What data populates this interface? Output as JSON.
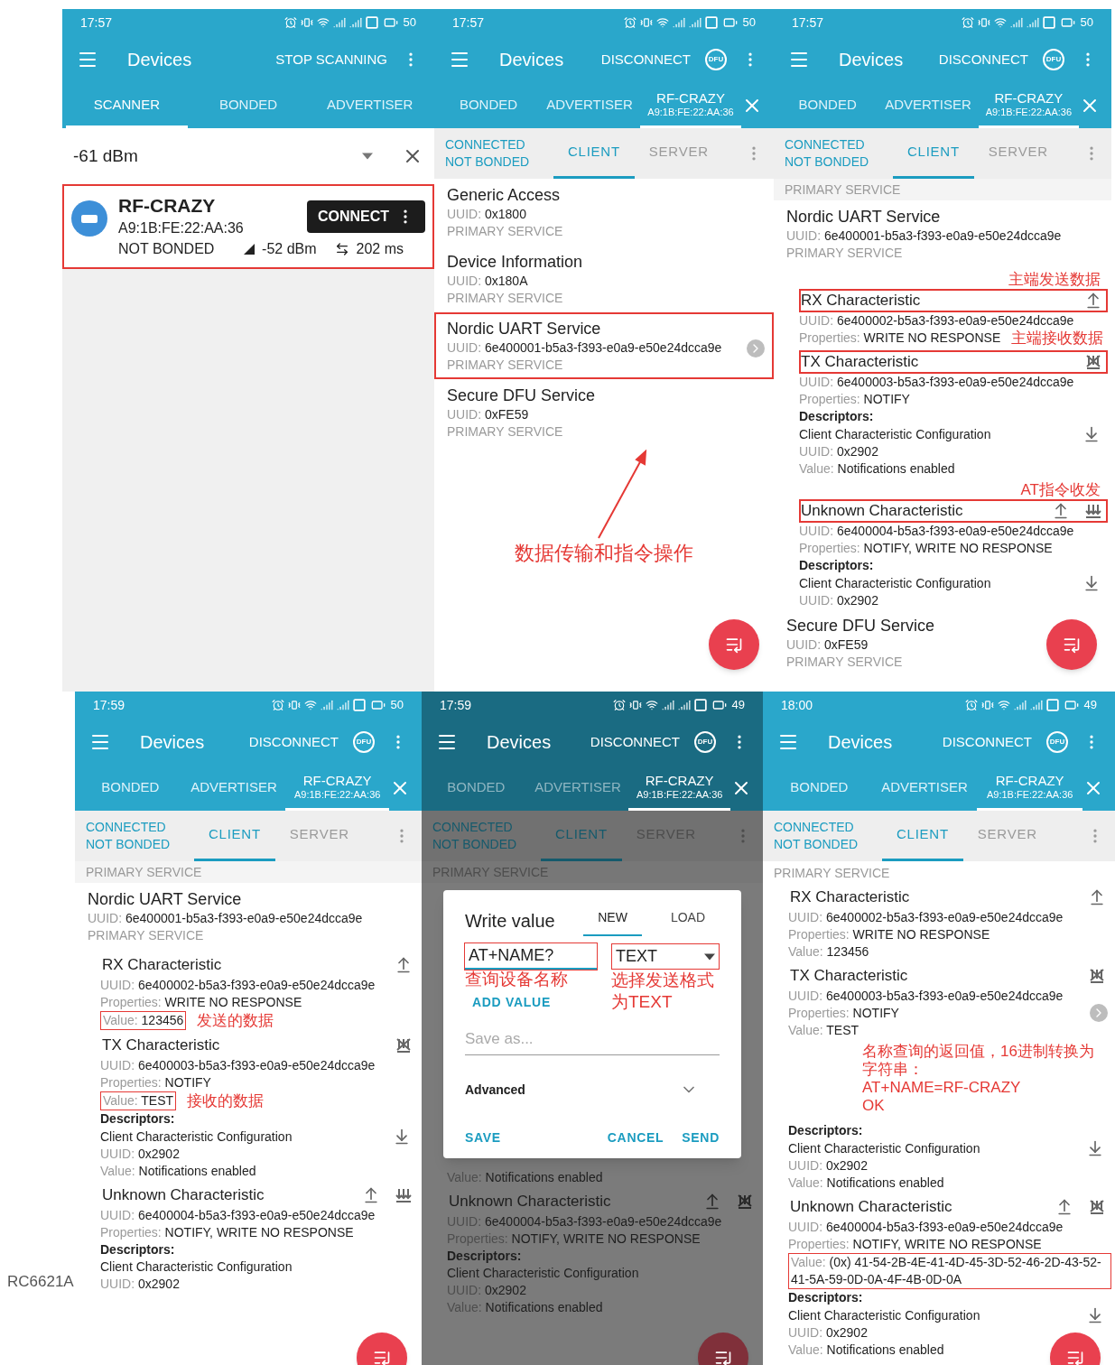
{
  "rows": [
    {
      "panels": [
        {
          "time": "17:57",
          "battery": "50",
          "title": "Devices",
          "action": "STOP SCANNING",
          "dimmed": false,
          "tabs": [
            {
              "label": "SCANNER",
              "selected": true
            },
            {
              "label": "BONDED",
              "selected": false
            },
            {
              "label": "ADVERTISER",
              "selected": false
            }
          ],
          "blocks": [
            {
              "kind": "filter",
              "value": "-61 dBm"
            },
            {
              "kind": "device",
              "boxed": true,
              "name": "RF-CRAZY",
              "address": "A9:1B:FE:22:AA:36",
              "bond": "NOT BONDED",
              "rssi": "-52 dBm",
              "interval": "202 ms",
              "button": "CONNECT"
            }
          ]
        },
        {
          "time": "17:57",
          "battery": "50",
          "title": "Devices",
          "action": "DISCONNECT",
          "dfu": "DFU",
          "dimmed": false,
          "fab": true,
          "closable": true,
          "tabs": [
            {
              "label": "BONDED",
              "selected": false
            },
            {
              "label": "ADVERTISER",
              "selected": false
            },
            {
              "label": "RF-CRAZY",
              "sublabel": "A9:1B:FE:22:AA:36",
              "selected": true
            }
          ],
          "subbar": {
            "status": [
              "CONNECTED",
              "NOT BONDED"
            ],
            "tabs": [
              {
                "label": "CLIENT",
                "selected": true
              },
              {
                "label": "SERVER",
                "selected": false
              }
            ]
          },
          "blocks": [
            {
              "kind": "service",
              "name": "Generic Access",
              "boxed": false,
              "lines": [
                {
                  "label": "UUID:",
                  "value": "0x1800"
                },
                {
                  "label": "PRIMARY SERVICE"
                }
              ]
            },
            {
              "kind": "service",
              "name": "Device Information",
              "boxed": false,
              "lines": [
                {
                  "label": "UUID:",
                  "value": "0x180A"
                },
                {
                  "label": "PRIMARY SERVICE"
                }
              ]
            },
            {
              "kind": "service",
              "name": "Nordic UART Service",
              "boxed": true,
              "chevron": true,
              "lines": [
                {
                  "label": "UUID:",
                  "value": "6e400001-b5a3-f393-e0a9-e50e24dcca9e"
                },
                {
                  "label": "PRIMARY SERVICE"
                }
              ]
            },
            {
              "kind": "service",
              "name": "Secure DFU Service",
              "boxed": false,
              "lines": [
                {
                  "label": "UUID:",
                  "value": "0xFE59"
                },
                {
                  "label": "PRIMARY SERVICE"
                }
              ]
            },
            {
              "kind": "note",
              "arrow": true,
              "lines": [
                "数据传输和指令操作"
              ]
            }
          ]
        },
        {
          "time": "17:57",
          "battery": "50",
          "title": "Devices",
          "action": "DISCONNECT",
          "dfu": "DFU",
          "dimmed": false,
          "fab": true,
          "closable": true,
          "tabs": [
            {
              "label": "BONDED",
              "selected": false
            },
            {
              "label": "ADVERTISER",
              "selected": false
            },
            {
              "label": "RF-CRAZY",
              "sublabel": "A9:1B:FE:22:AA:36",
              "selected": true
            }
          ],
          "subbar": {
            "status": [
              "CONNECTED",
              "NOT BONDED"
            ],
            "tabs": [
              {
                "label": "CLIENT",
                "selected": true
              },
              {
                "label": "SERVER",
                "selected": false
              }
            ]
          },
          "blocks": [
            {
              "kind": "label",
              "text": "PRIMARY SERVICE"
            },
            {
              "kind": "service",
              "name": "Nordic UART Service",
              "boxed": false,
              "lines": [
                {
                  "label": "UUID:",
                  "value": "6e400001-b5a3-f393-e0a9-e50e24dcca9e"
                },
                {
                  "label": "PRIMARY SERVICE"
                }
              ]
            },
            {
              "kind": "characteristic",
              "note": "主端发送数据",
              "name": "RX Characteristic",
              "boxed": true,
              "writable": true,
              "lines": [
                {
                  "label": "UUID:",
                  "value": "6e400002-b5a3-f393-e0a9-e50e24dcca9e"
                },
                {
                  "label": "Properties:",
                  "value": "WRITE NO RESPONSE",
                  "note": "主端接收数据"
                }
              ]
            },
            {
              "kind": "characteristic",
              "name": "TX Characteristic",
              "boxed": true,
              "notifying": false,
              "lines": [
                {
                  "label": "UUID:",
                  "value": "6e400003-b5a3-f393-e0a9-e50e24dcca9e"
                },
                {
                  "label": "Properties:",
                  "value": "NOTIFY"
                }
              ],
              "descriptors": {
                "heading": "Descriptors:",
                "items": [
                  {
                    "name": "Client Characteristic Configuration",
                    "readable": true,
                    "lines": [
                      {
                        "label": "UUID:",
                        "value": "0x2902"
                      },
                      {
                        "label": "Value:",
                        "value": "Notifications enabled"
                      }
                    ]
                  }
                ]
              }
            },
            {
              "kind": "characteristic",
              "note": "AT指令收发",
              "name": "Unknown Characteristic",
              "boxed": true,
              "writable": true,
              "notifying": true,
              "lines": [
                {
                  "label": "UUID:",
                  "value": "6e400004-b5a3-f393-e0a9-e50e24dcca9e"
                },
                {
                  "label": "Properties:",
                  "value": "NOTIFY, WRITE NO RESPONSE"
                }
              ],
              "descriptors": {
                "heading": "Descriptors:",
                "items": [
                  {
                    "name": "Client Characteristic Configuration",
                    "readable": true,
                    "lines": [
                      {
                        "label": "UUID:",
                        "value": "0x2902"
                      }
                    ]
                  }
                ]
              }
            },
            {
              "kind": "service",
              "name": "Secure DFU Service",
              "boxed": false,
              "lines": [
                {
                  "label": "UUID:",
                  "value": "0xFE59"
                },
                {
                  "label": "PRIMARY SERVICE"
                }
              ]
            }
          ]
        }
      ]
    },
    {
      "side_text": "RC6621A",
      "panels": [
        {
          "time": "17:59",
          "battery": "50",
          "title": "Devices",
          "action": "DISCONNECT",
          "dfu": "DFU",
          "dimmed": false,
          "fab": true,
          "closable": true,
          "tabs": [
            {
              "label": "BONDED",
              "selected": false
            },
            {
              "label": "ADVERTISER",
              "selected": false
            },
            {
              "label": "RF-CRAZY",
              "sublabel": "A9:1B:FE:22:AA:36",
              "selected": true
            }
          ],
          "subbar": {
            "status": [
              "CONNECTED",
              "NOT BONDED"
            ],
            "tabs": [
              {
                "label": "CLIENT",
                "selected": true
              },
              {
                "label": "SERVER",
                "selected": false
              }
            ]
          },
          "blocks": [
            {
              "kind": "label",
              "text": "PRIMARY SERVICE"
            },
            {
              "kind": "service",
              "name": "Nordic UART Service",
              "boxed": false,
              "lines": [
                {
                  "label": "UUID:",
                  "value": "6e400001-b5a3-f393-e0a9-e50e24dcca9e"
                },
                {
                  "label": "PRIMARY SERVICE"
                }
              ]
            },
            {
              "kind": "characteristic",
              "name": "RX Characteristic",
              "boxed": false,
              "writable": true,
              "lines": [
                {
                  "label": "UUID:",
                  "value": "6e400002-b5a3-f393-e0a9-e50e24dcca9e"
                },
                {
                  "label": "Properties:",
                  "value": "WRITE NO RESPONSE"
                },
                {
                  "label": "Value:",
                  "value": "123456",
                  "boxed": true,
                  "note": "发送的数据"
                }
              ]
            },
            {
              "kind": "characteristic",
              "name": "TX Characteristic",
              "boxed": false,
              "notifying": false,
              "lines": [
                {
                  "label": "UUID:",
                  "value": "6e400003-b5a3-f393-e0a9-e50e24dcca9e"
                },
                {
                  "label": "Properties:",
                  "value": "NOTIFY"
                },
                {
                  "label": "Value:",
                  "value": "TEST",
                  "boxed": true,
                  "note": "接收的数据"
                }
              ],
              "descriptors": {
                "heading": "Descriptors:",
                "items": [
                  {
                    "name": "Client Characteristic Configuration",
                    "readable": true,
                    "lines": [
                      {
                        "label": "UUID:",
                        "value": "0x2902"
                      },
                      {
                        "label": "Value:",
                        "value": "Notifications enabled"
                      }
                    ]
                  }
                ]
              }
            },
            {
              "kind": "characteristic",
              "name": "Unknown Characteristic",
              "boxed": false,
              "writable": true,
              "notifying": true,
              "lines": [
                {
                  "label": "UUID:",
                  "value": "6e400004-b5a3-f393-e0a9-e50e24dcca9e"
                },
                {
                  "label": "Properties:",
                  "value": "NOTIFY, WRITE NO RESPONSE"
                }
              ],
              "descriptors": {
                "heading": "Descriptors:",
                "items": [
                  {
                    "name": "Client Characteristic Configuration",
                    "lines": [
                      {
                        "label": "UUID:",
                        "value": "0x2902"
                      }
                    ]
                  }
                ]
              }
            }
          ]
        },
        {
          "time": "17:59",
          "battery": "49",
          "title": "Devices",
          "action": "DISCONNECT",
          "dfu": "DFU",
          "dimmed": true,
          "fab": true,
          "closable": true,
          "tabs": [
            {
              "label": "BONDED",
              "selected": false
            },
            {
              "label": "ADVERTISER",
              "selected": false
            },
            {
              "label": "RF-CRAZY",
              "sublabel": "A9:1B:FE:22:AA:36",
              "selected": true
            }
          ],
          "subbar": {
            "status": [
              "CONNECTED",
              "NOT BONDED"
            ],
            "tabs": [
              {
                "label": "CLIENT",
                "selected": true
              },
              {
                "label": "SERVER",
                "selected": false
              }
            ]
          },
          "blocks": [
            {
              "kind": "label",
              "text": "PRIMARY SERVICE"
            },
            {
              "kind": "dialog",
              "title": "Write value",
              "tabs": [
                {
                  "label": "NEW",
                  "selected": true
                },
                {
                  "label": "LOAD",
                  "selected": false
                }
              ],
              "value": {
                "text": "AT+NAME?",
                "boxed": true,
                "note": "查询设备名称"
              },
              "format": {
                "text": "TEXT",
                "boxed": true,
                "note": "选择发送格式为TEXT"
              },
              "add_label": "ADD VALUE",
              "save_placeholder": "Save as...",
              "advanced": "Advanced",
              "buttons": [
                "SAVE",
                "CANCEL",
                "SEND"
              ]
            },
            {
              "kind": "char_tail",
              "lines": [
                {
                  "label": "Value:",
                  "value": "Notifications enabled"
                }
              ]
            },
            {
              "kind": "characteristic",
              "name": "Unknown Characteristic",
              "boxed": false,
              "writable": true,
              "notifying": false,
              "lines": [
                {
                  "label": "UUID:",
                  "value": "6e400004-b5a3-f393-e0a9-e50e24dcca9e"
                },
                {
                  "label": "Properties:",
                  "value": "NOTIFY, WRITE NO RESPONSE"
                }
              ],
              "descriptors": {
                "heading": "Descriptors:",
                "items": [
                  {
                    "name": "Client Characteristic Configuration",
                    "lines": [
                      {
                        "label": "UUID:",
                        "value": "0x2902"
                      },
                      {
                        "label": "Value:",
                        "value": "Notifications enabled"
                      }
                    ]
                  }
                ]
              }
            }
          ]
        },
        {
          "time": "18:00",
          "battery": "49",
          "title": "Devices",
          "action": "DISCONNECT",
          "dfu": "DFU",
          "dimmed": false,
          "fab": true,
          "closable": true,
          "tabs": [
            {
              "label": "BONDED",
              "selected": false
            },
            {
              "label": "ADVERTISER",
              "selected": false
            },
            {
              "label": "RF-CRAZY",
              "sublabel": "A9:1B:FE:22:AA:36",
              "selected": true
            }
          ],
          "subbar": {
            "status": [
              "CONNECTED",
              "NOT BONDED"
            ],
            "tabs": [
              {
                "label": "CLIENT",
                "selected": true
              },
              {
                "label": "SERVER",
                "selected": false
              }
            ]
          },
          "blocks": [
            {
              "kind": "service_tail",
              "lines": [
                {
                  "label": "PRIMARY SERVICE"
                }
              ]
            },
            {
              "kind": "characteristic",
              "name": "RX Characteristic",
              "boxed": false,
              "writable": true,
              "lines": [
                {
                  "label": "UUID:",
                  "value": "6e400002-b5a3-f393-e0a9-e50e24dcca9e"
                },
                {
                  "label": "Properties:",
                  "value": "WRITE NO RESPONSE"
                },
                {
                  "label": "Value:",
                  "value": "123456"
                }
              ]
            },
            {
              "kind": "characteristic",
              "name": "TX Characteristic",
              "boxed": false,
              "chevron": true,
              "notifying": false,
              "lines": [
                {
                  "label": "UUID:",
                  "value": "6e400003-b5a3-f393-e0a9-e50e24dcca9e"
                },
                {
                  "label": "Properties:",
                  "value": "NOTIFY"
                },
                {
                  "label": "Value:",
                  "value": "TEST"
                }
              ]
            },
            {
              "kind": "note",
              "lines": [
                "名称查询的返回值，16进制转换为字符串：",
                "AT+NAME=RF-CRAZY",
                "OK"
              ]
            },
            {
              "kind": "char_tail",
              "descriptors": {
                "heading": "Descriptors:",
                "items": [
                  {
                    "name": "Client Characteristic Configuration",
                    "readable": true,
                    "lines": [
                      {
                        "label": "UUID:",
                        "value": "0x2902"
                      },
                      {
                        "label": "Value:",
                        "value": "Notifications enabled"
                      }
                    ]
                  }
                ]
              }
            },
            {
              "kind": "characteristic",
              "name": "Unknown Characteristic",
              "boxed": false,
              "writable": true,
              "notifying": false,
              "lines": [
                {
                  "label": "UUID:",
                  "value": "6e400004-b5a3-f393-e0a9-e50e24dcca9e"
                },
                {
                  "label": "Properties:",
                  "value": "NOTIFY, WRITE NO RESPONSE"
                },
                {
                  "label": "Value:",
                  "value": "(0x) 41-54-2B-4E-41-4D-45-3D-52-46-2D-43-52-41-5A-59-0D-0A-4F-4B-0D-0A",
                  "boxed": true
                }
              ],
              "descriptors": {
                "heading": "Descriptors:",
                "items": [
                  {
                    "name": "Client Characteristic Configuration",
                    "readable": true,
                    "lines": [
                      {
                        "label": "UUID:",
                        "value": "0x2902"
                      },
                      {
                        "label": "Value:",
                        "value": "Notifications enabled"
                      }
                    ]
                  }
                ]
              }
            }
          ]
        }
      ]
    }
  ]
}
